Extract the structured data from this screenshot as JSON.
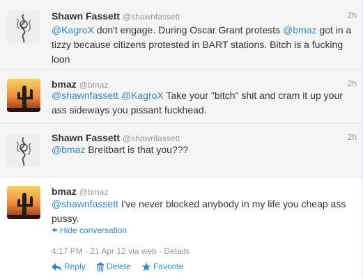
{
  "tweets": [
    {
      "fullname": "Shawn Fassett",
      "username": "@shawnfassett",
      "time": "2h",
      "text": [
        {
          "mention": "@KagroX"
        },
        {
          "plain": " don't engage. During Oscar Grant protests "
        },
        {
          "mention": "@bmaz"
        },
        {
          "plain": " got in a tizzy because citizens protested in BART stations. Bitch is a fucking loon"
        }
      ]
    },
    {
      "fullname": "bmaz",
      "username": "@bmaz",
      "time": "2h",
      "text": [
        {
          "mention": "@shawnfassett"
        },
        {
          "plain": " "
        },
        {
          "mention": "@KagroX"
        },
        {
          "plain": " Take your \"bitch\" shit and cram it up your ass sideways you pissant fuckhead."
        }
      ]
    },
    {
      "fullname": "Shawn Fassett",
      "username": "@shawnfassett",
      "time": "2h",
      "text": [
        {
          "mention": "@bmaz"
        },
        {
          "plain": " Breitbart is that you???"
        }
      ]
    },
    {
      "fullname": "bmaz",
      "username": "@bmaz",
      "time": "",
      "text": [
        {
          "mention": "@shawnfassett"
        },
        {
          "plain": " I've never blocked anybody in my life you cheap ass pussy."
        }
      ],
      "hide_conversation": "Hide conversation",
      "hide_icon": "arrow-left-icon",
      "meta": "4:17 PM - 21 Apr 12 via web · Details",
      "actions": {
        "reply": "Reply",
        "delete": "Delete",
        "favorite": "Favorite"
      }
    }
  ],
  "colors": {
    "link": "#2f87c4",
    "secondary": "#999999",
    "collapsed_bg": "#f5f5f5"
  }
}
